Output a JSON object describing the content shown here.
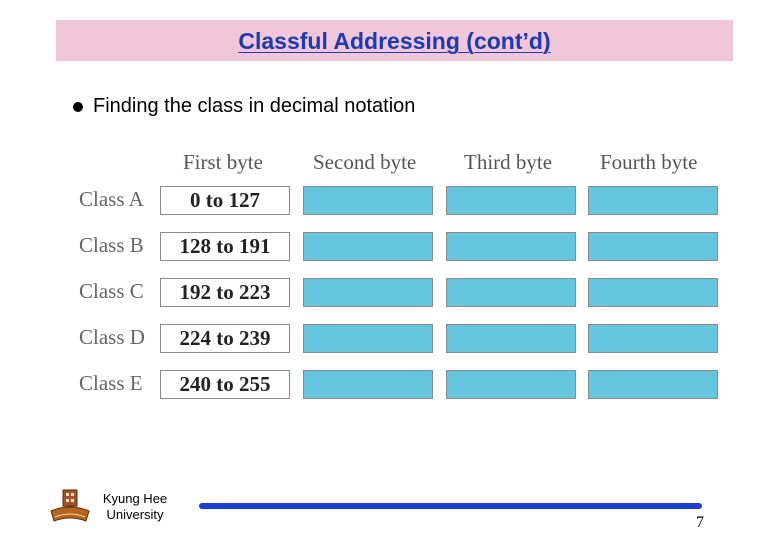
{
  "slide": {
    "title": "Classful Addressing (cont’d)",
    "bullet": "Finding the class in decimal notation",
    "colors": {
      "title_bg": "#f2c6d9",
      "title_text": "#1a3bb3",
      "byte_fill": "#66c5df",
      "footer_line": "#1d3fd6"
    }
  },
  "table": {
    "headers": [
      "First byte",
      "Second byte",
      "Third byte",
      "Fourth byte"
    ],
    "rows": [
      {
        "label": "Class A",
        "range": "0 to 127"
      },
      {
        "label": "Class B",
        "range": "128 to 191"
      },
      {
        "label": "Class C",
        "range": "192 to 223"
      },
      {
        "label": "Class D",
        "range": "224 to 239"
      },
      {
        "label": "Class E",
        "range": "240 to 255"
      }
    ]
  },
  "footer": {
    "university_line1": "Kyung Hee",
    "university_line2": "University",
    "logo_icon": "university-emblem-icon",
    "page_number": "7"
  }
}
